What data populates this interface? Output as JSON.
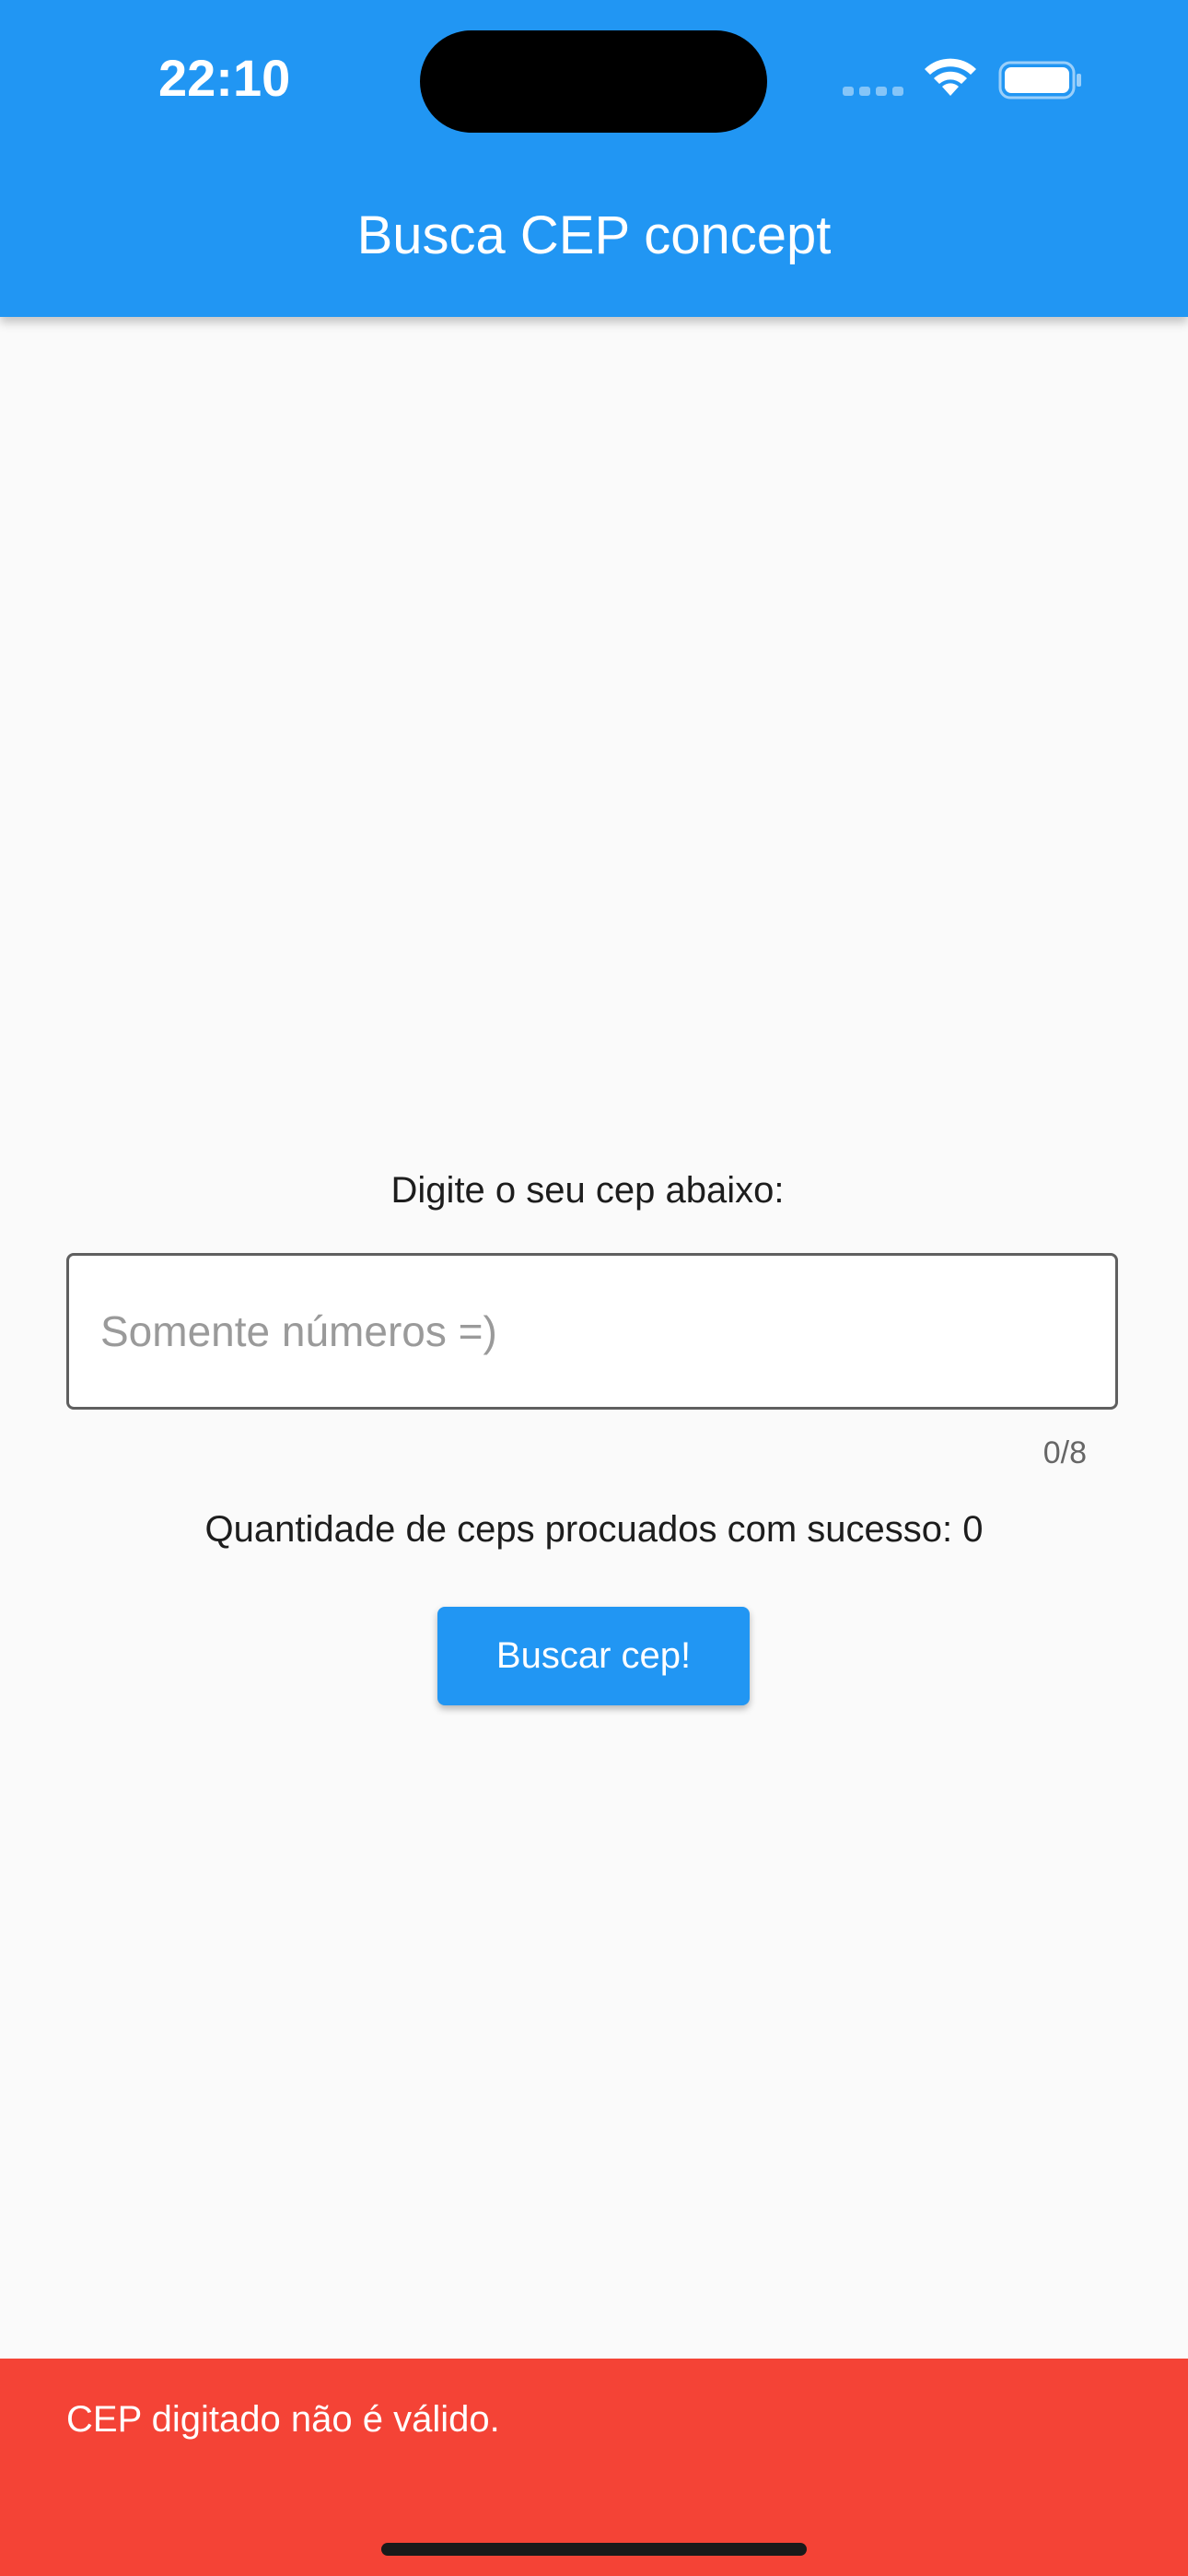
{
  "status_bar": {
    "time": "22:10",
    "icons": [
      "cellular-signal-icon",
      "wifi-icon",
      "battery-icon"
    ]
  },
  "appbar": {
    "title": "Busca CEP concept"
  },
  "main": {
    "prompt": "Digite o seu cep abaixo:",
    "cep_input": {
      "value": "",
      "placeholder": "Somente números =)",
      "counter": "0/8"
    },
    "success_count_text": "Quantidade de ceps procuados com sucesso: 0",
    "search_button_label": "Buscar cep!"
  },
  "snackbar": {
    "message": "CEP digitado não é válido."
  },
  "colors": {
    "primary": "#2196f3",
    "error": "#f44336",
    "background": "#fafafa"
  }
}
